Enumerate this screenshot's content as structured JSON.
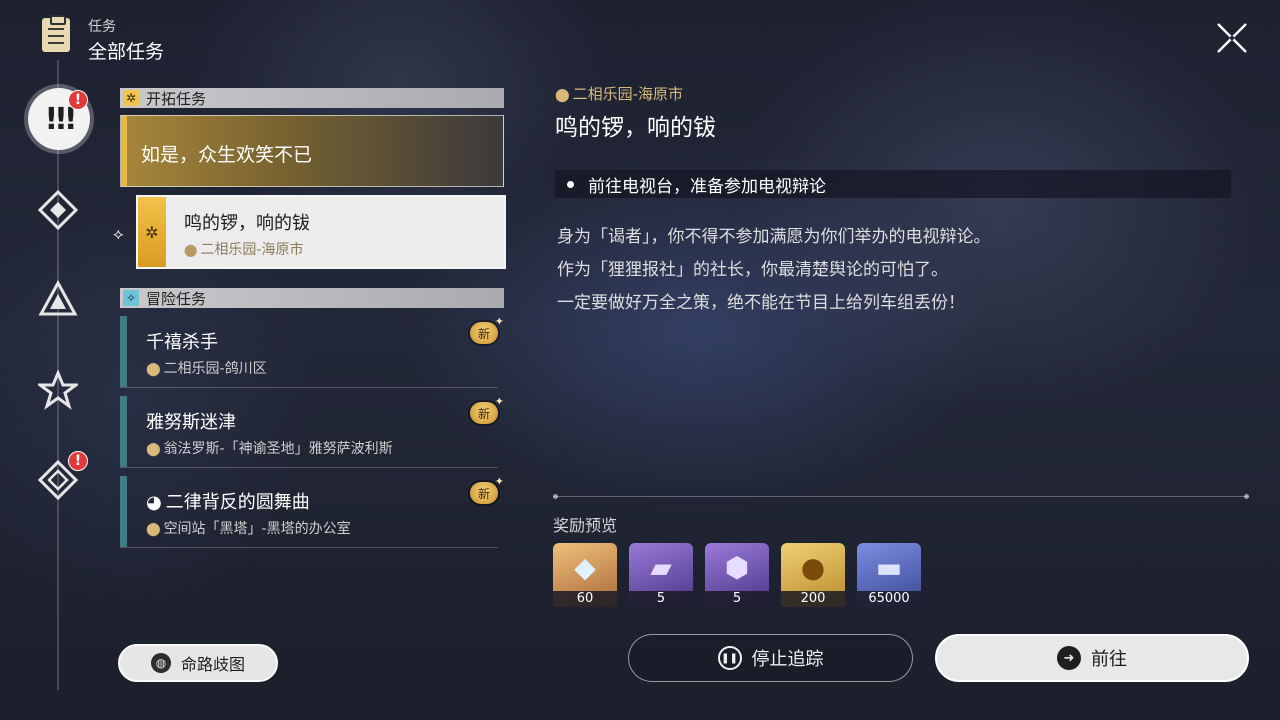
{
  "header": {
    "subtitle": "任务",
    "title": "全部任务"
  },
  "sidebar": {
    "badges": [
      "!",
      "!"
    ]
  },
  "trailblaze_section": {
    "label": "开拓任务",
    "main_quest": "如是，众生欢笑不已",
    "selected": {
      "title": "鸣的锣，响的钹",
      "location": "二相乐园-海原市"
    }
  },
  "adventure_section": {
    "label": "冒险任务",
    "items": [
      {
        "title": "千禧杀手",
        "location": "二相乐园-鸽川区",
        "badge": "新"
      },
      {
        "title": "雅努斯迷津",
        "location": "翁法罗斯-「神谕圣地」雅努萨波利斯",
        "badge": "新"
      },
      {
        "title": "二律背反的圆舞曲",
        "location": "空间站「黑塔」-黑塔的办公室",
        "badge": "新"
      }
    ]
  },
  "map_button": "命路歧图",
  "detail": {
    "location": "二相乐园-海原市",
    "title": "鸣的锣，响的钹",
    "objective": "前往电视台，准备参加电视辩论",
    "description": [
      "身为「谒者」，你不得不参加满愿为你们举办的电视辩论。",
      "作为「狸狸报社」的社长，你最清楚舆论的可怕了。",
      "一定要做好万全之策，绝不能在节目上给列车组丢份！"
    ]
  },
  "rewards": {
    "label": "奖励预览",
    "items": [
      {
        "icon": "crystal-icon",
        "count": "60",
        "color": "#e8a35a"
      },
      {
        "icon": "purple-book-icon",
        "count": "5",
        "color": "#6b4fb0"
      },
      {
        "icon": "purple-potion-icon",
        "count": "5",
        "color": "#6b4fb0"
      },
      {
        "icon": "credit-coin-icon",
        "count": "200",
        "color": "#d9a53a"
      },
      {
        "icon": "blue-ticket-icon",
        "count": "65000",
        "color": "#4a5fb0"
      }
    ]
  },
  "actions": {
    "stop": "停止追踪",
    "go": "前往"
  },
  "colors": {
    "accent_gold": "#e8b845",
    "adventure_teal": "#3f7c84",
    "location_gold": "#d9b97a",
    "badge_red": "#e03a3a"
  }
}
